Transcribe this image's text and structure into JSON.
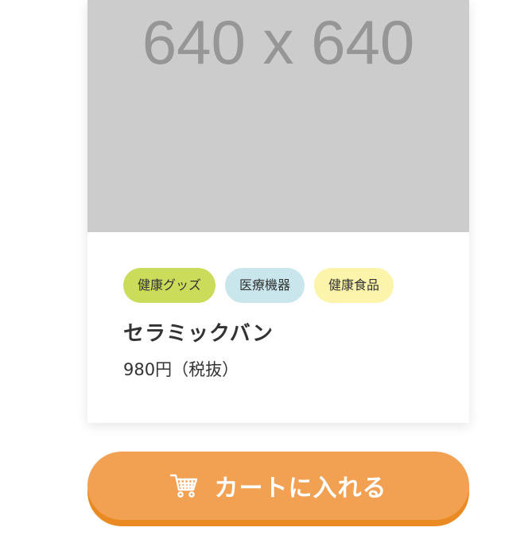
{
  "product": {
    "image_placeholder": "640 x 640",
    "tags": [
      {
        "label": "健康グッズ",
        "color": "#cbdb5a"
      },
      {
        "label": "医療機器",
        "color": "#c8e6ec"
      },
      {
        "label": "健康食品",
        "color": "#fbf4aa"
      }
    ],
    "name": "セラミックバン",
    "price": "980円（税抜）"
  },
  "cart_button": {
    "label": "カートに入れる",
    "icon": "cart-icon",
    "color": "#f2a153",
    "shadow_color": "#e98a22"
  },
  "colors": {
    "image_background": "#cccccc",
    "placeholder_text": "#969696",
    "text": "#333333"
  }
}
